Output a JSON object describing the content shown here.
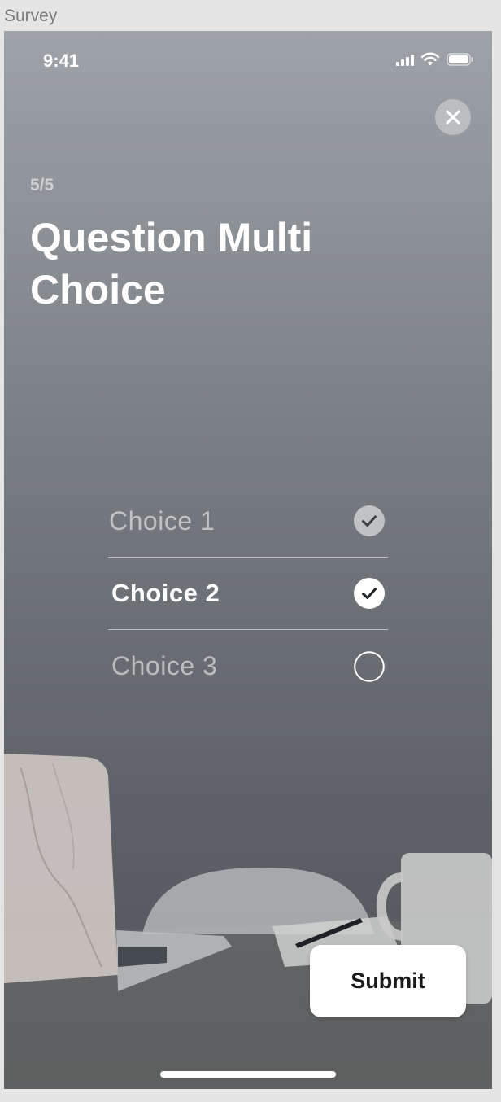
{
  "frame_label": "Survey",
  "status_bar": {
    "time": "9:41"
  },
  "survey": {
    "progress": "5/5",
    "title": "Question Multi Choice",
    "choices": [
      {
        "label": "Choice 1",
        "state": "checked-dim"
      },
      {
        "label": "Choice 2",
        "state": "checked"
      },
      {
        "label": "Choice 3",
        "state": "unchecked"
      }
    ],
    "submit_label": "Submit"
  },
  "icons": {
    "close": "close-icon",
    "signal": "signal-icon",
    "wifi": "wifi-icon",
    "battery": "battery-icon",
    "check": "checkmark-icon",
    "radio": "radio-empty-icon"
  },
  "colors": {
    "background_top": "#9ea3a7",
    "background_bottom": "#4f5357",
    "button_bg": "#ffffff",
    "text_primary": "#ffffff"
  }
}
